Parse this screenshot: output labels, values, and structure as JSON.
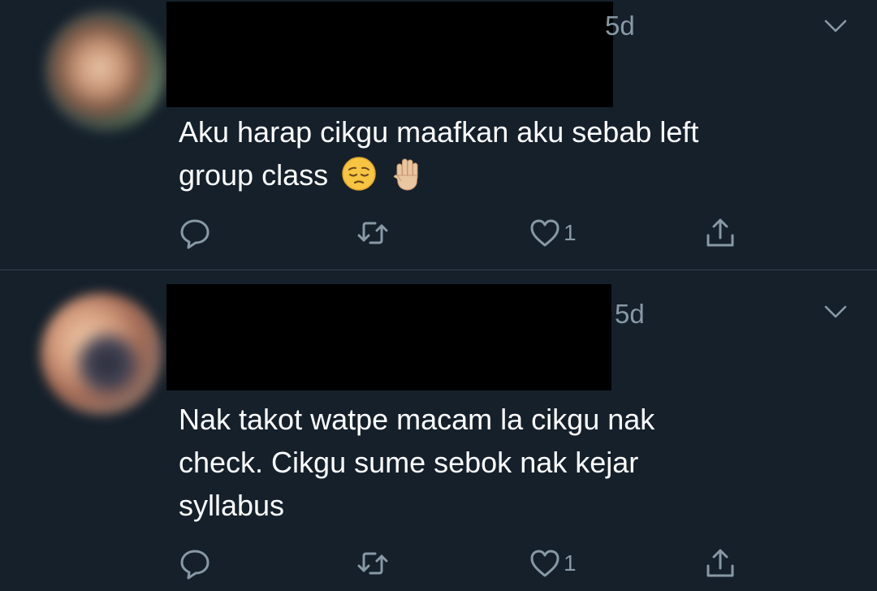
{
  "tweets": [
    {
      "time": "5d",
      "text_lines": [
        "Aku harap cikgu maafkan aku sebab left",
        "group class"
      ],
      "emojis": [
        "pensive-face",
        "raised-hand-medium-light-skin"
      ],
      "like_count": "1"
    },
    {
      "time": "5d",
      "text_lines": [
        "Nak takot watpe macam la cikgu nak",
        "check. Cikgu sume sebok nak kejar",
        "syllabus"
      ],
      "like_count": "1"
    }
  ],
  "theme": {
    "background": "#15202b",
    "text": "#ffffff",
    "secondary": "#8899a6",
    "divider": "#38444d"
  }
}
